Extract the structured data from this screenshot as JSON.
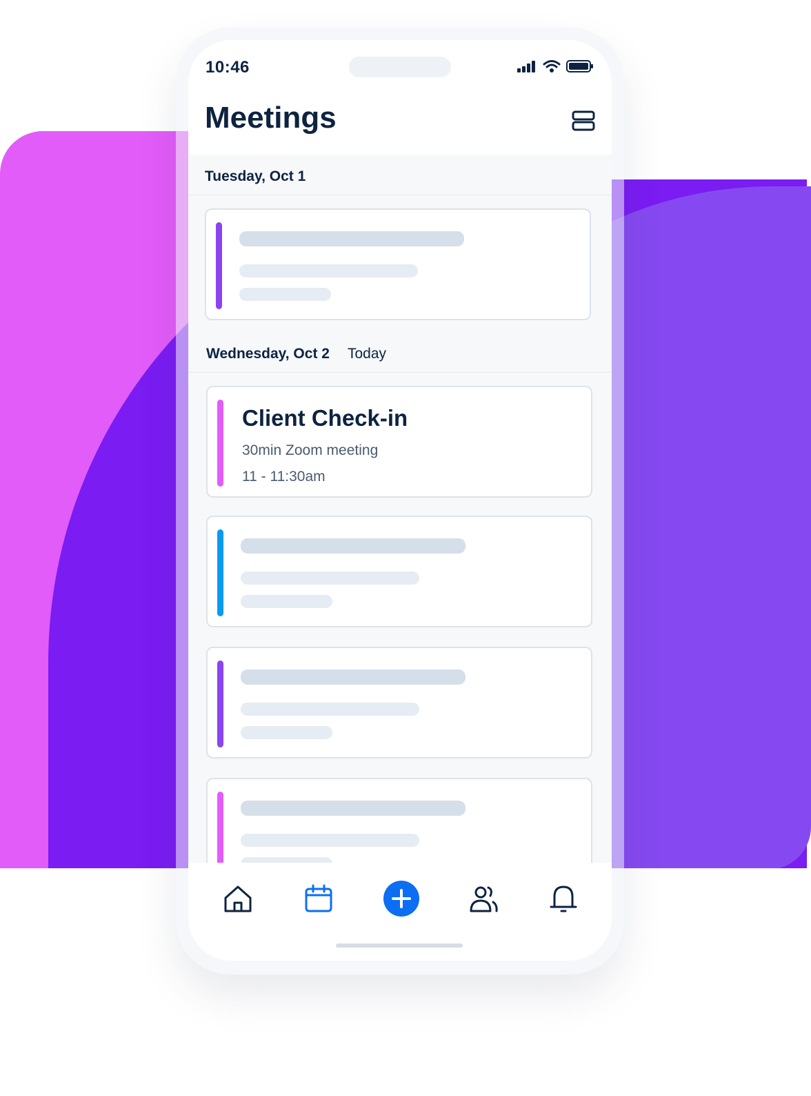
{
  "colors": {
    "background_pink": "#e25cf9",
    "background_violet": "#7a1cf2",
    "background_purple": "#8649f1",
    "text_dark": "#0d2340",
    "accent_blue": "#0b6ef3",
    "bar_purple": "#8a44f0",
    "bar_pink": "#e25cf9",
    "bar_blue": "#0a9bf0"
  },
  "status_bar": {
    "time": "10:46",
    "icons": [
      "signal-icon",
      "wifi-icon",
      "battery-icon"
    ]
  },
  "header": {
    "title": "Meetings",
    "view_toggle_icon": "list-view-icon"
  },
  "sections": [
    {
      "date": "Tuesday, Oct 1",
      "tag": ""
    },
    {
      "date": "Wednesday, Oct 2",
      "tag": "Today"
    }
  ],
  "meetings": [
    {
      "loading": true,
      "accent": "purple"
    },
    {
      "loading": false,
      "accent": "pink",
      "title": "Client Check-in",
      "subtitle": "30min Zoom meeting",
      "time": "11 - 11:30am"
    },
    {
      "loading": true,
      "accent": "blue"
    },
    {
      "loading": true,
      "accent": "purple"
    },
    {
      "loading": true,
      "accent": "pink"
    }
  ],
  "tab_bar": {
    "items": [
      {
        "icon": "home-icon",
        "active": false
      },
      {
        "icon": "calendar-icon",
        "active": true
      },
      {
        "icon": "plus-icon",
        "active": false
      },
      {
        "icon": "people-icon",
        "active": false
      },
      {
        "icon": "bell-icon",
        "active": false
      }
    ]
  }
}
